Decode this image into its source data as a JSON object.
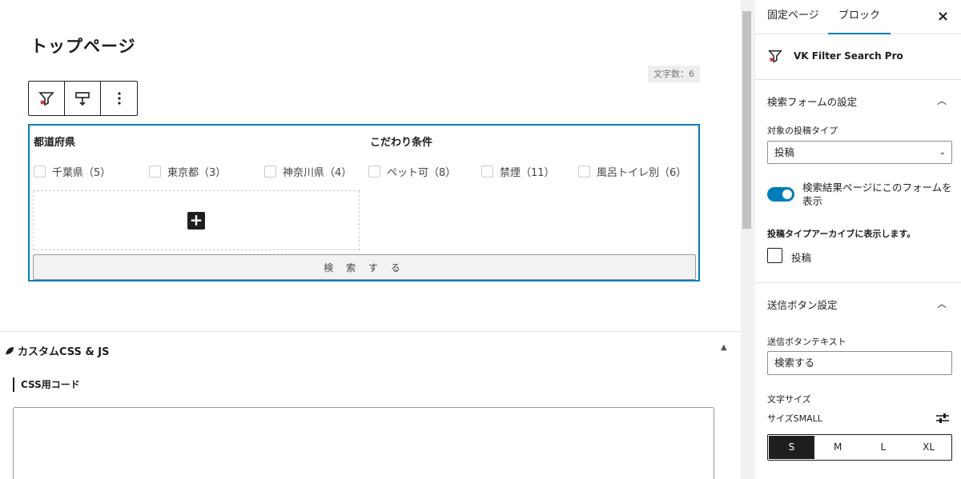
{
  "editor": {
    "page_title": "トップページ",
    "char_count": "文字数：6",
    "block": {
      "col1_heading": "都道府県",
      "col2_heading": "こだわり条件",
      "options": [
        "千葉県（5）",
        "東京都（3）",
        "神奈川県（4）",
        "ペット可（8）",
        "禁煙（11）",
        "風呂トイレ別（6）"
      ],
      "submit_label": "検 索 す る"
    },
    "meta_box": {
      "title": "カスタムCSS & JS",
      "css_label": "CSS用コード"
    }
  },
  "sidebar": {
    "tabs": [
      "固定ページ",
      "ブロック"
    ],
    "active_tab": "ブロック",
    "block_name": "VK Filter Search Pro",
    "panel1_title": "検索フォームの設定",
    "post_type_label": "対象の投稿タイプ",
    "post_type_value": "投稿",
    "toggle_label": "検索結果ページにこのフォームを表示",
    "archive_label": "投稿タイプアーカイブに表示します。",
    "archive_option": "投稿",
    "panel2_title": "送信ボタン設定",
    "button_text_label": "送信ボタンテキスト",
    "button_text_value": "検索する",
    "font_size_label": "文字サイズ",
    "size_sub_label": "サイズSMALL",
    "sizes": [
      "S",
      "M",
      "L",
      "XL"
    ],
    "active_size": "S"
  },
  "colors": {
    "accent": "#007cba",
    "dark": "#1e1e1e"
  }
}
